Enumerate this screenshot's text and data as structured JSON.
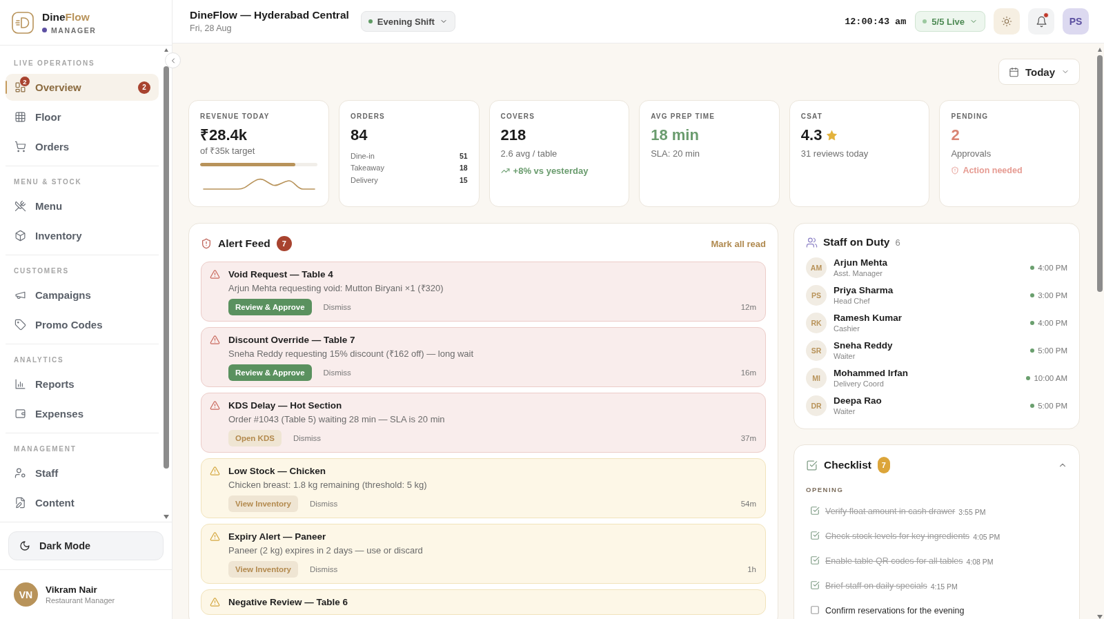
{
  "sidebar": {
    "brand": {
      "name_primary": "Dine",
      "name_accent": "Flow",
      "role": "MANAGER"
    },
    "sections": [
      {
        "label": "LIVE OPERATIONS",
        "items": [
          {
            "label": "Overview",
            "selected": true,
            "icon_badge": "2",
            "badge": "2"
          },
          {
            "label": "Floor",
            "selected": false
          },
          {
            "label": "Orders",
            "selected": false
          }
        ]
      },
      {
        "label": "MENU & STOCK",
        "items": [
          {
            "label": "Menu",
            "selected": false
          },
          {
            "label": "Inventory",
            "selected": false
          }
        ]
      },
      {
        "label": "CUSTOMERS",
        "items": [
          {
            "label": "Campaigns",
            "selected": false
          },
          {
            "label": "Promo Codes",
            "selected": false
          }
        ]
      },
      {
        "label": "ANALYTICS",
        "items": [
          {
            "label": "Reports",
            "selected": false
          },
          {
            "label": "Expenses",
            "selected": false
          }
        ]
      },
      {
        "label": "MANAGEMENT",
        "items": [
          {
            "label": "Staff",
            "selected": false
          },
          {
            "label": "Content",
            "selected": false
          }
        ]
      }
    ],
    "dark_mode_button": "Dark Mode",
    "user": {
      "initials": "VN",
      "name": "Vikram Nair",
      "role": "Restaurant Manager"
    }
  },
  "header": {
    "title": "DineFlow — Hyderabad Central",
    "date": "Fri, 28 Aug",
    "shift": "Evening Shift",
    "clock": "12:00:43 am",
    "live_status": "5/5 Live",
    "has_unread": true,
    "avatar": "PS"
  },
  "toolbar": {
    "date_range": "Today"
  },
  "stats": [
    {
      "kind": "revenue",
      "label": "REVENUE TODAY",
      "value": "₹28.4k",
      "color": "#1c1c1c",
      "caption": "of ₹35k target",
      "level": 0.81
    },
    {
      "kind": "breakdown",
      "label": "ORDERS",
      "value": "84",
      "color": "#1c1c1c",
      "rows": [
        {
          "label": "Dine-in",
          "value": "51"
        },
        {
          "label": "Takeaway",
          "value": "18"
        },
        {
          "label": "Delivery",
          "value": "15"
        }
      ]
    },
    {
      "kind": "trend",
      "label": "COVERS",
      "value": "218",
      "color": "#1c1c1c",
      "caption": "2.6 avg / table",
      "trend": "+8% vs yesterday"
    },
    {
      "kind": "plain",
      "label": "AVG PREP TIME",
      "value": "18 min",
      "color": "#6a9c6e",
      "caption": "SLA: 20 min"
    },
    {
      "kind": "rating",
      "label": "CSAT",
      "value": "4.3",
      "color": "#1c1c1c",
      "caption": "31 reviews today"
    },
    {
      "kind": "alert",
      "label": "PENDING",
      "value": "2",
      "color": "#d98473",
      "caption": "Approvals",
      "note": "Action needed"
    }
  ],
  "alert_feed": {
    "title": "Alert Feed",
    "count": "7",
    "mark_all_read": "Mark all read",
    "alerts": [
      {
        "kind": "critical",
        "title": "Void Request — Table 4",
        "description": "Arjun Mehta requesting void: Mutton Biryani ×1 (₹320)",
        "action": {
          "label": "Review & Approve",
          "kind": "primary"
        },
        "dismiss": "Dismiss",
        "time": "12m"
      },
      {
        "kind": "critical",
        "title": "Discount Override — Table 7",
        "description": "Sneha Reddy requesting 15% discount (₹162 off) — long wait",
        "action": {
          "label": "Review & Approve",
          "kind": "primary"
        },
        "dismiss": "Dismiss",
        "time": "16m"
      },
      {
        "kind": "critical",
        "title": "KDS Delay — Hot Section",
        "description": "Order #1043 (Table 5) waiting 28 min — SLA is 20 min",
        "action": {
          "label": "Open KDS",
          "kind": "secondary"
        },
        "dismiss": "Dismiss",
        "time": "37m"
      },
      {
        "kind": "warning",
        "title": "Low Stock — Chicken",
        "description": "Chicken breast: 1.8 kg remaining (threshold: 5 kg)",
        "action": {
          "label": "View Inventory",
          "kind": "secondary"
        },
        "dismiss": "Dismiss",
        "time": "54m"
      },
      {
        "kind": "warning",
        "title": "Expiry Alert — Paneer",
        "description": "Paneer (2 kg) expires in 2 days — use or discard",
        "action": {
          "label": "View Inventory",
          "kind": "secondary"
        },
        "dismiss": "Dismiss",
        "time": "1h"
      },
      {
        "kind": "warning",
        "title": "Negative Review — Table 6"
      }
    ]
  },
  "staff_on_duty": {
    "title": "Staff on Duty",
    "count": "6",
    "members": [
      {
        "initials": "AM",
        "name": "Arjun Mehta",
        "role": "Asst. Manager",
        "since": "4:00 PM",
        "active": true
      },
      {
        "initials": "PS",
        "name": "Priya Sharma",
        "role": "Head Chef",
        "since": "3:00 PM",
        "active": true
      },
      {
        "initials": "RK",
        "name": "Ramesh Kumar",
        "role": "Cashier",
        "since": "4:00 PM",
        "active": true
      },
      {
        "initials": "SR",
        "name": "Sneha Reddy",
        "role": "Waiter",
        "since": "5:00 PM",
        "active": true
      },
      {
        "initials": "MI",
        "name": "Mohammed Irfan",
        "role": "Delivery Coord",
        "since": "10:00 AM",
        "active": true
      },
      {
        "initials": "DR",
        "name": "Deepa Rao",
        "role": "Waiter",
        "since": "5:00 PM",
        "active": true
      }
    ]
  },
  "checklist": {
    "title": "Checklist",
    "count": "7",
    "expanded": true,
    "sections": [
      {
        "label": "OPENING",
        "items": [
          {
            "text": "Verify float amount in cash drawer",
            "time": "3:55 PM",
            "checked": true
          },
          {
            "text": "Check stock levels for key ingredients",
            "time": "4:05 PM",
            "checked": true
          },
          {
            "text": "Enable table QR codes for all tables",
            "time": "4:08 PM",
            "checked": true
          },
          {
            "text": "Brief staff on daily specials",
            "time": "4:15 PM",
            "checked": true
          },
          {
            "text": "Confirm reservations for the evening",
            "checked": false
          }
        ]
      }
    ]
  }
}
